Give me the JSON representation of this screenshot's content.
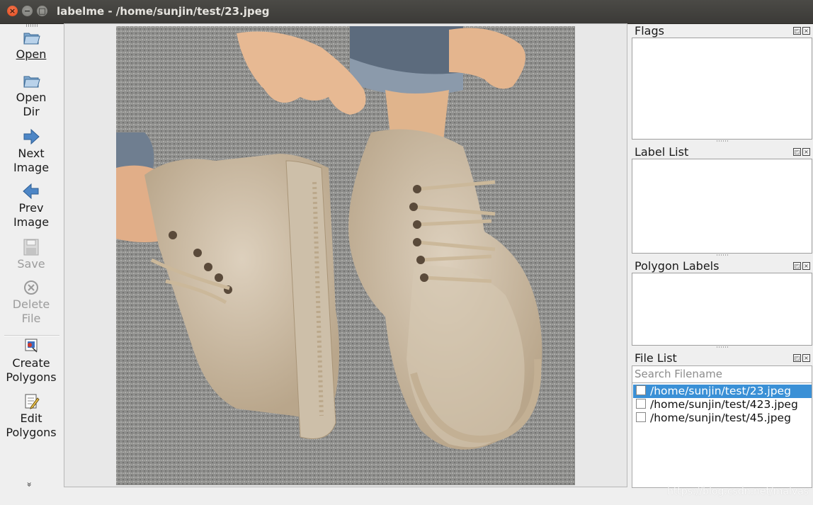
{
  "window": {
    "title": "labelme - /home/sunjin/test/23.jpeg",
    "close_glyph": "×",
    "min_glyph": "−",
    "max_glyph": "□"
  },
  "toolbar": {
    "items": [
      {
        "label": "Open",
        "icon": "folder-open-icon",
        "enabled": true
      },
      {
        "label": "Open\nDir",
        "icon": "folder-open-icon",
        "enabled": true
      },
      {
        "label": "Next\nImage",
        "icon": "arrow-right-icon",
        "enabled": true
      },
      {
        "label": "Prev\nImage",
        "icon": "arrow-left-icon",
        "enabled": true
      },
      {
        "label": "Save",
        "icon": "floppy-disk-icon",
        "enabled": false
      },
      {
        "label": "Delete\nFile",
        "icon": "delete-circle-icon",
        "enabled": false
      },
      {
        "label": "Create\nPolygons",
        "icon": "create-polygon-icon",
        "enabled": true
      },
      {
        "label": "Edit\nPolygons",
        "icon": "edit-polygon-icon",
        "enabled": true
      }
    ],
    "more_glyph": "»"
  },
  "docks": {
    "flags": {
      "title": "Flags"
    },
    "label_list": {
      "title": "Label List"
    },
    "polygon_labels": {
      "title": "Polygon Labels"
    },
    "file_list": {
      "title": "File List",
      "search_placeholder": "Search Filename",
      "files": [
        {
          "path": "/home/sunjin/test/23.jpeg",
          "checked": false,
          "selected": true
        },
        {
          "path": "/home/sunjin/test/423.jpeg",
          "checked": false,
          "selected": false
        },
        {
          "path": "/home/sunjin/test/45.jpeg",
          "checked": false,
          "selected": false
        }
      ]
    },
    "float_glyph": "◰",
    "close_glyph": "×"
  },
  "watermark": "https://blog.csdn.net/malvas",
  "colors": {
    "selection": "#3a90d6",
    "close_button": "#e2471a",
    "titlebar": "#3b3a37"
  }
}
